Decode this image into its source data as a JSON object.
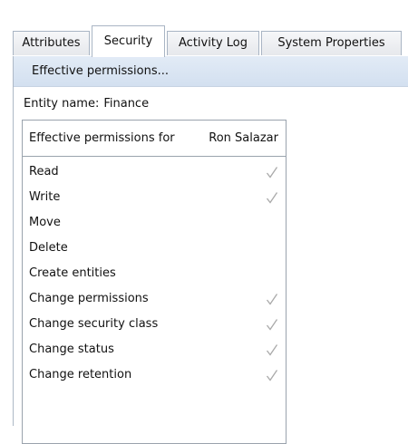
{
  "tabs": [
    {
      "label": "Attributes",
      "active": false
    },
    {
      "label": "Security",
      "active": true
    },
    {
      "label": "Activity Log",
      "active": false
    },
    {
      "label": "System Properties",
      "active": false
    }
  ],
  "toolbar": {
    "effective_permissions_label": "Effective permissions..."
  },
  "entity": {
    "label": "Entity name:",
    "value": "Finance"
  },
  "permissions": {
    "header_label": "Effective permissions for",
    "user": "Ron Salazar",
    "rows": [
      {
        "name": "Read",
        "granted": true
      },
      {
        "name": "Write",
        "granted": true
      },
      {
        "name": "Move",
        "granted": false
      },
      {
        "name": "Delete",
        "granted": false
      },
      {
        "name": "Create entities",
        "granted": false
      },
      {
        "name": "Change permissions",
        "granted": true
      },
      {
        "name": "Change security class",
        "granted": true
      },
      {
        "name": "Change status",
        "granted": true
      },
      {
        "name": "Change retention",
        "granted": true
      }
    ]
  },
  "colors": {
    "check": "#a9a9a9",
    "toolbar_top": "#e2ebf6",
    "toolbar_bottom": "#d3e0f0",
    "tab_border": "#a9b5c4"
  },
  "icons": {
    "granted": "check-icon"
  }
}
